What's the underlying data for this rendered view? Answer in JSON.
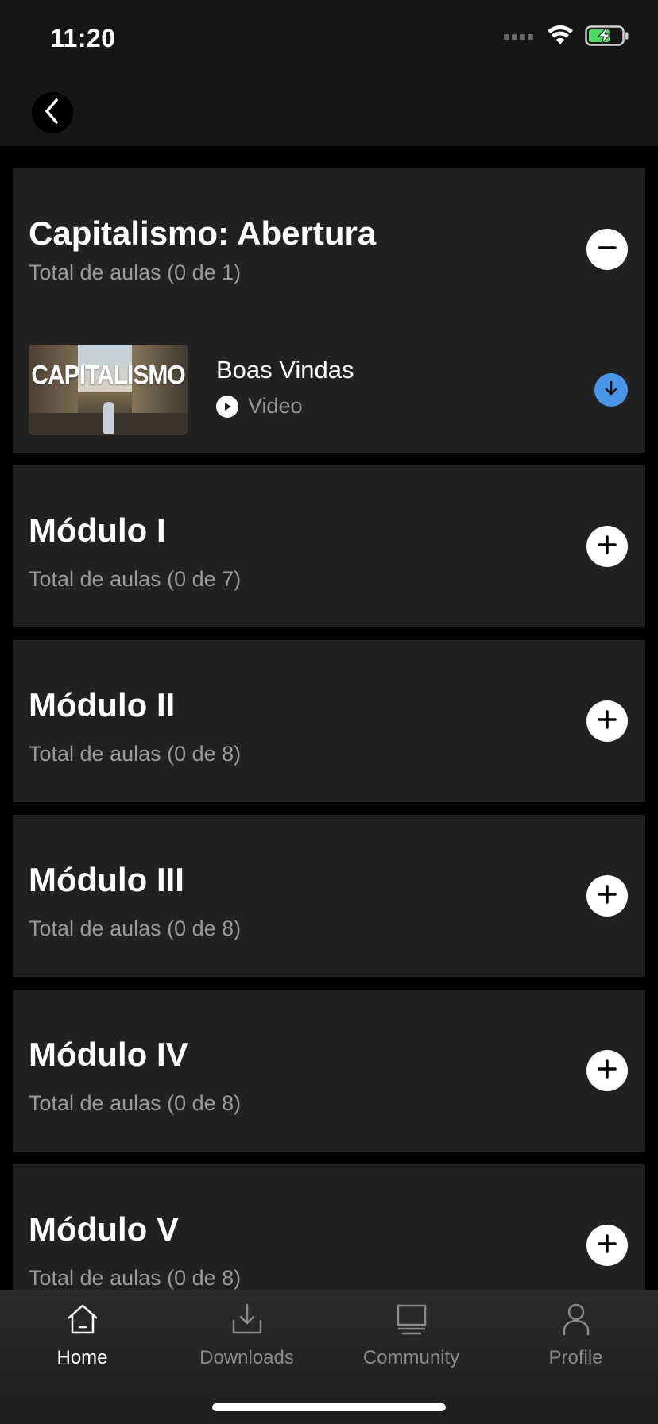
{
  "status_bar": {
    "time": "11:20",
    "icons": [
      "signal-icon",
      "wifi-icon",
      "battery-charging-icon"
    ],
    "battery_color": "#4cd964"
  },
  "header": {
    "back_icon": "chevron-left-icon"
  },
  "modules": [
    {
      "title": "Capitalismo: Abertura",
      "count": "Total de aulas (0 de 1)",
      "expanded": true,
      "toggle_icon": "minus-icon",
      "lessons": [
        {
          "thumbnail_text": "CAPITALISMO",
          "title": "Boas Vindas",
          "type": "Video",
          "type_icon": "play-icon",
          "action_icon": "download-icon",
          "action_color": "#4a95e8"
        }
      ]
    },
    {
      "title": "Módulo I",
      "count": "Total de aulas (0 de 7)",
      "expanded": false,
      "toggle_icon": "plus-icon"
    },
    {
      "title": "Módulo II",
      "count": "Total de aulas (0 de 8)",
      "expanded": false,
      "toggle_icon": "plus-icon"
    },
    {
      "title": "Módulo III",
      "count": "Total de aulas (0 de 8)",
      "expanded": false,
      "toggle_icon": "plus-icon"
    },
    {
      "title": "Módulo IV",
      "count": "Total de aulas (0 de 8)",
      "expanded": false,
      "toggle_icon": "plus-icon"
    },
    {
      "title": "Módulo V",
      "count": "Total de aulas (0 de 8)",
      "expanded": false,
      "toggle_icon": "plus-icon"
    }
  ],
  "tab_bar": {
    "tabs": [
      {
        "label": "Home",
        "icon": "home-icon",
        "active": true
      },
      {
        "label": "Downloads",
        "icon": "download-tray-icon",
        "active": false
      },
      {
        "label": "Community",
        "icon": "monitor-icon",
        "active": false
      },
      {
        "label": "Profile",
        "icon": "user-icon",
        "active": false
      }
    ]
  },
  "colors": {
    "background": "#000000",
    "card": "#212121",
    "header": "#161616",
    "muted_text": "#9a9a9a",
    "accent": "#4a95e8"
  }
}
